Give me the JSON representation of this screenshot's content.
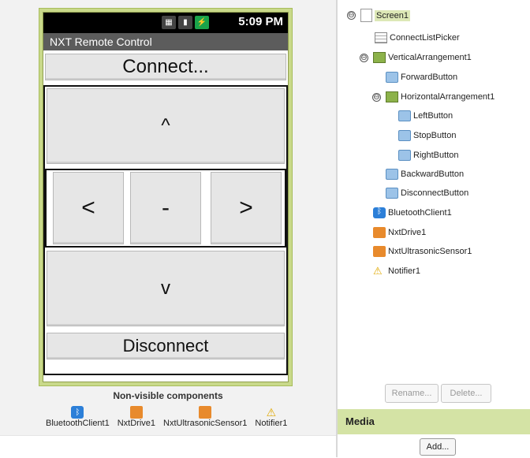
{
  "phone": {
    "status": {
      "time": "5:09 PM",
      "icons": [
        "sim-icon",
        "signal-icon",
        "battery-icon"
      ]
    },
    "title": "NXT Remote Control",
    "connect_label": "Connect...",
    "forward_label": "^",
    "left_label": "<",
    "stop_label": "-",
    "right_label": ">",
    "backward_label": "v",
    "disconnect_label": "Disconnect"
  },
  "nonvisible": {
    "title": "Non-visible components",
    "items": [
      {
        "label": "BluetoothClient1",
        "icon": "bluetooth-icon"
      },
      {
        "label": "NxtDrive1",
        "icon": "nxt-icon"
      },
      {
        "label": "NxtUltrasonicSensor1",
        "icon": "nxt-icon"
      },
      {
        "label": "Notifier1",
        "icon": "warning-icon"
      }
    ]
  },
  "tree": {
    "nodes": [
      {
        "label": "Screen1",
        "icon": "screen-icon"
      },
      {
        "label": "ConnectListPicker",
        "icon": "listpicker-icon"
      },
      {
        "label": "VerticalArrangement1",
        "icon": "vertical-arrangement-icon"
      },
      {
        "label": "ForwardButton",
        "icon": "button-icon"
      },
      {
        "label": "HorizontalArrangement1",
        "icon": "horizontal-arrangement-icon"
      },
      {
        "label": "LeftButton",
        "icon": "button-icon"
      },
      {
        "label": "StopButton",
        "icon": "button-icon"
      },
      {
        "label": "RightButton",
        "icon": "button-icon"
      },
      {
        "label": "BackwardButton",
        "icon": "button-icon"
      },
      {
        "label": "DisconnectButton",
        "icon": "button-icon"
      },
      {
        "label": "BluetoothClient1",
        "icon": "bluetooth-icon"
      },
      {
        "label": "NxtDrive1",
        "icon": "nxt-icon"
      },
      {
        "label": "NxtUltrasonicSensor1",
        "icon": "nxt-icon"
      },
      {
        "label": "Notifier1",
        "icon": "warning-icon"
      }
    ],
    "toggle_symbol": "⊖",
    "rename_label": "Rename...",
    "delete_label": "Delete..."
  },
  "media": {
    "title": "Media",
    "add_label": "Add..."
  },
  "colors": {
    "phone_frame": "#c9d98a",
    "media_header": "#d4e3a5",
    "selected": "#dde8b6"
  }
}
